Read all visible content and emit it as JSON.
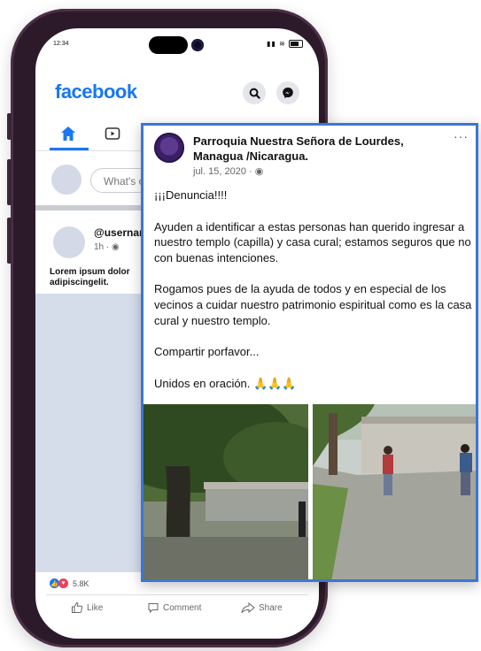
{
  "status": {
    "time": "12:34"
  },
  "app": {
    "logo": "facebook"
  },
  "header_icons": [
    "search-icon",
    "messenger-icon"
  ],
  "nav": {
    "items": [
      "home-icon",
      "video-icon",
      "marketplace-icon",
      "profile-icon",
      "notifications-icon",
      "menu-icon"
    ],
    "active": "home"
  },
  "composer": {
    "placeholder": "What's o"
  },
  "feed_post": {
    "username": "@username",
    "time": "1h · ",
    "text": "Lorem ipsum dolor adipiscingelit.",
    "reaction_count": "5.8K",
    "actions": {
      "like": "Like",
      "comment": "Comment",
      "share": "Share"
    }
  },
  "overlay_post": {
    "page_name": "Parroquia Nuestra Señora de Lourdes, Managua /Nicaragua.",
    "date": "jul. 15, 2020 · ",
    "more": "···",
    "paragraphs": [
      "¡¡¡Denuncia!!!!",
      "Ayuden a identificar a estas personas han querido ingresar a nuestro templo (capilla)  y casa cural; estamos seguros que no con buenas intenciones.",
      "Rogamos pues de la ayuda de todos y en especial de los vecinos a cuidar nuestro patrimonio espiritual como es la casa cural y nuestro templo.",
      "Compartir porfavor...",
      "Unidos en oración. 🙏🙏🙏"
    ]
  },
  "colors": {
    "facebook_blue": "#1877f2",
    "card_border": "#3d75d6",
    "phone_frame": "#2c1a2a"
  }
}
